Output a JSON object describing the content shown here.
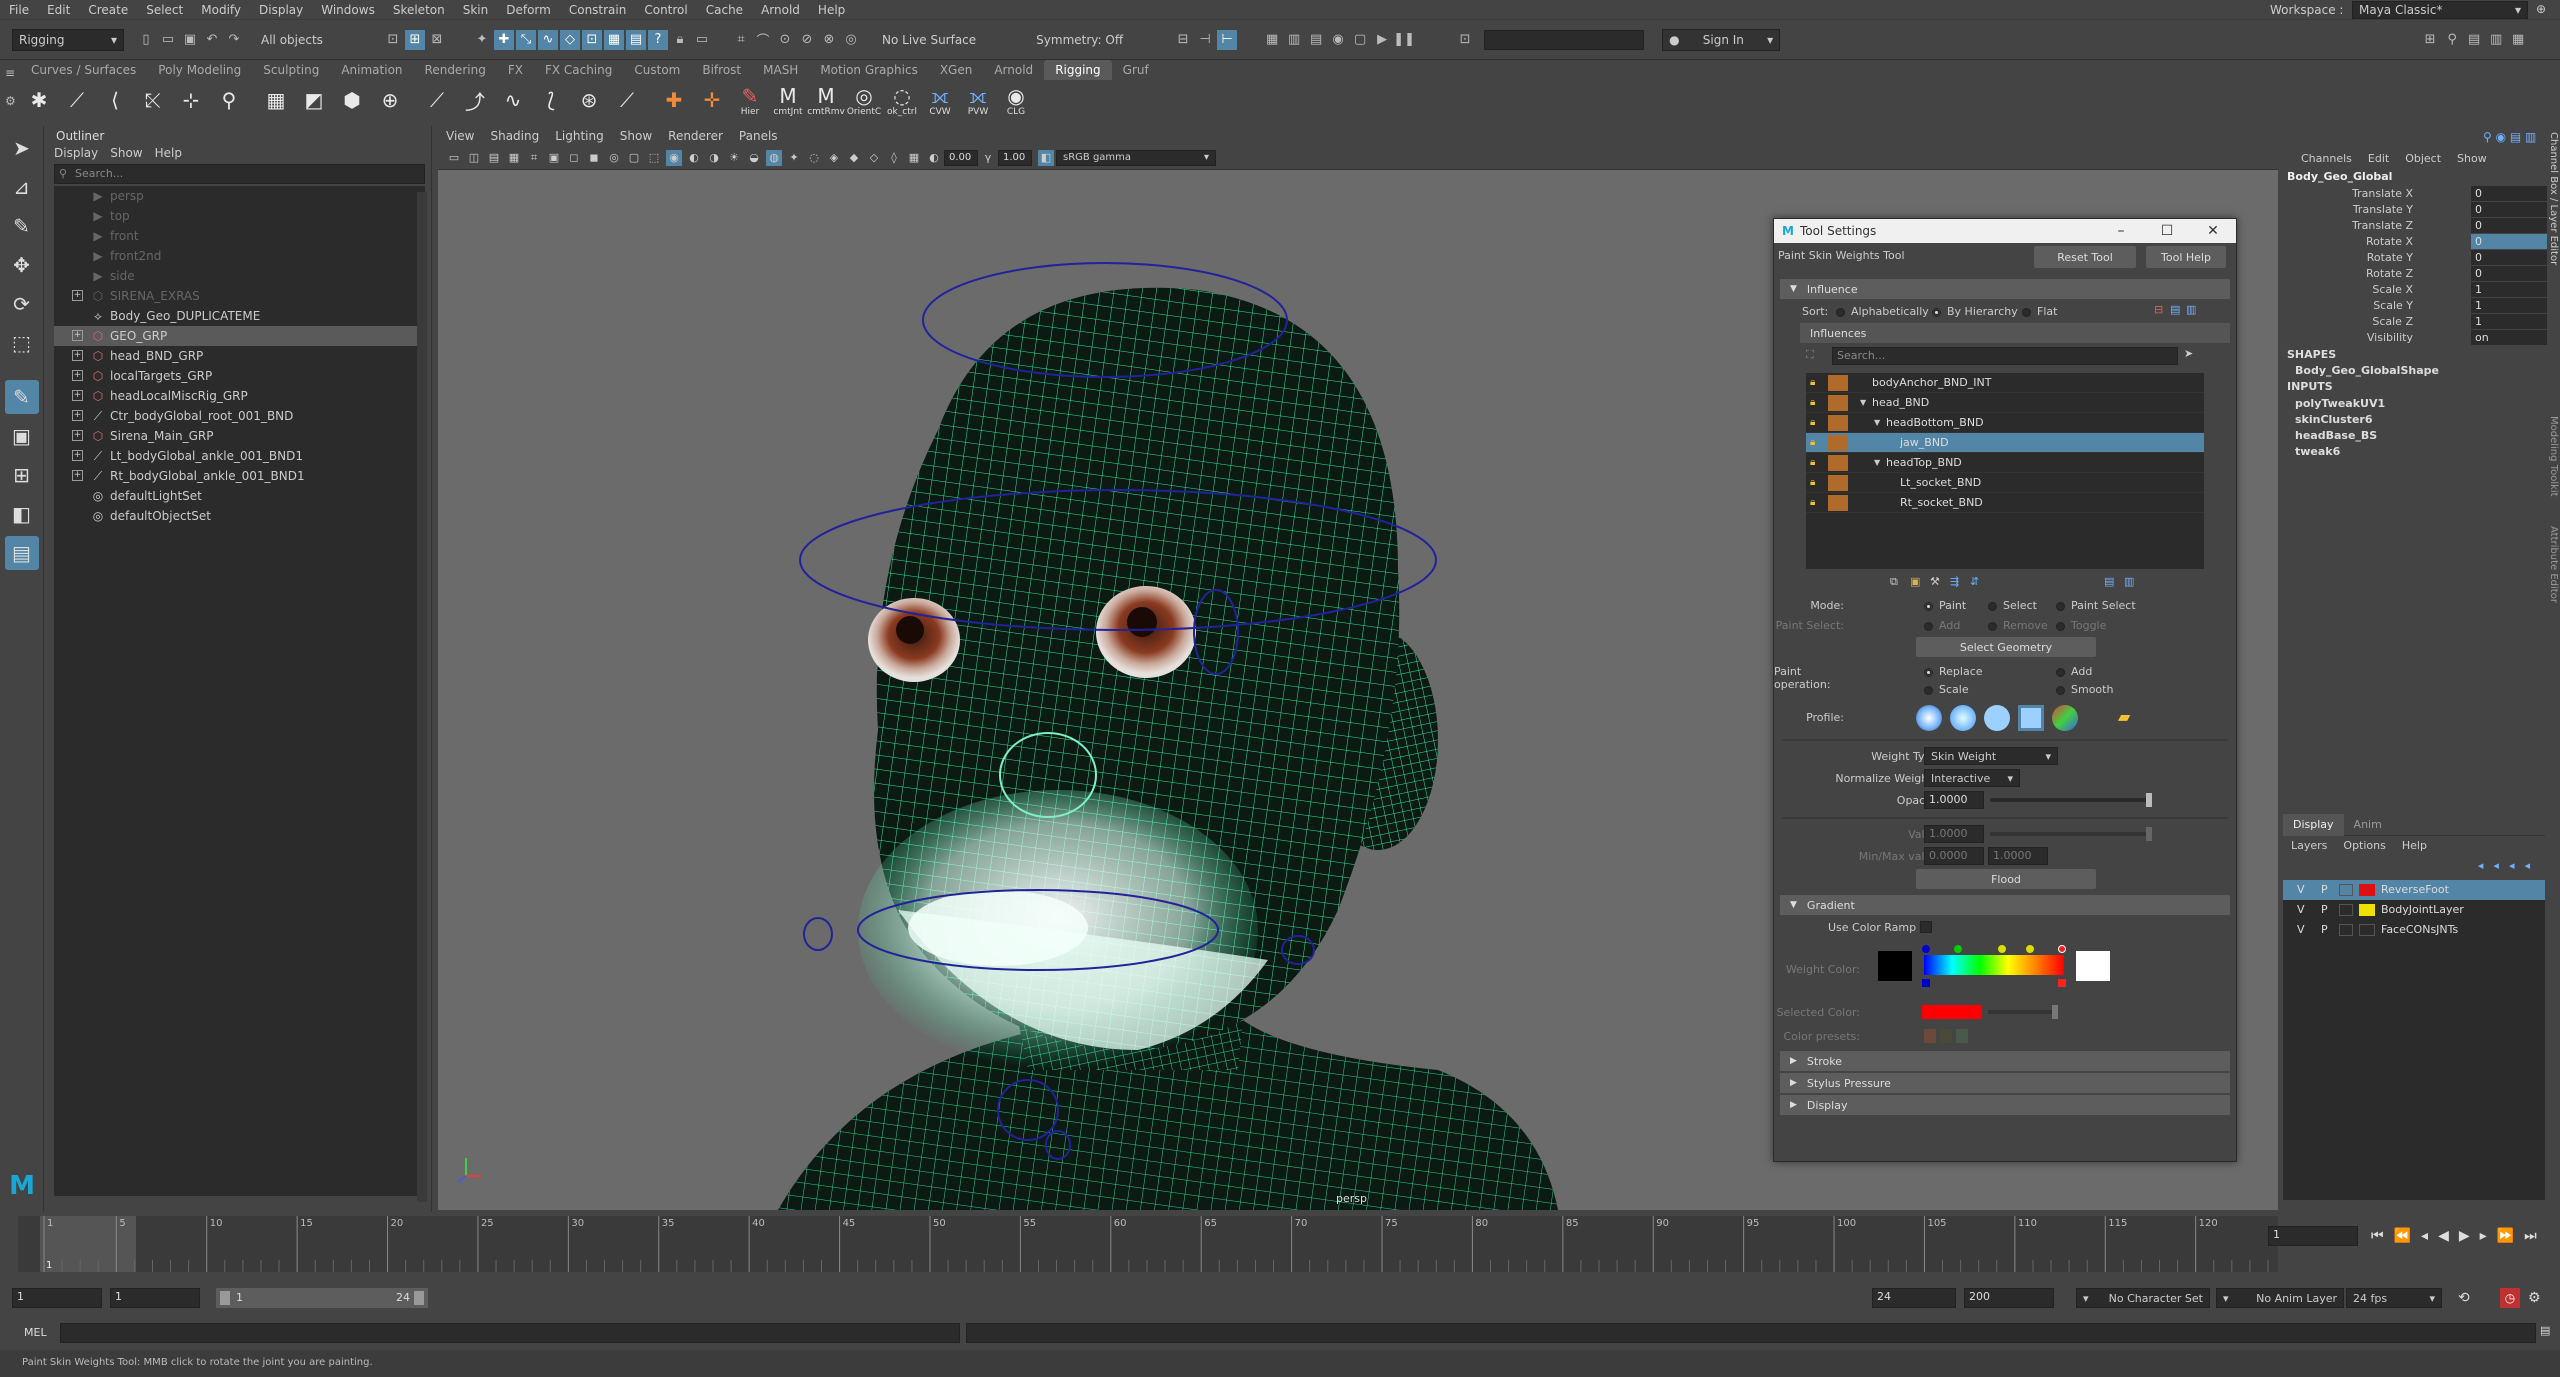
{
  "menubar": {
    "items": [
      "File",
      "Edit",
      "Create",
      "Select",
      "Modify",
      "Display",
      "Windows",
      "Skeleton",
      "Skin",
      "Deform",
      "Constrain",
      "Control",
      "Cache",
      "Arnold",
      "Help"
    ],
    "workspace_label": "Workspace :",
    "workspace_value": "Maya Classic*"
  },
  "statusline": {
    "menuset": "Rigging",
    "select_mode": "All objects",
    "live_surface": "No Live Surface",
    "symmetry": "Symmetry: Off",
    "sign_in": "Sign In"
  },
  "shelf": {
    "tabs": [
      "Curves / Surfaces",
      "Poly Modeling",
      "Sculpting",
      "Animation",
      "Rendering",
      "FX",
      "FX Caching",
      "Custom",
      "Bifrost",
      "MASH",
      "Motion Graphics",
      "XGen",
      "Arnold",
      "Rigging",
      "Gruf"
    ],
    "active_tab": "Rigging",
    "labeled_icons": [
      "Hier",
      "cmtJnt",
      "cmtRmv",
      "OrientC",
      "ok_ctrl",
      "CVW",
      "PVW",
      "CLG"
    ]
  },
  "outliner": {
    "title": "Outliner",
    "menu": [
      "Display",
      "Show",
      "Help"
    ],
    "search_placeholder": "Search...",
    "items": [
      {
        "label": "persp",
        "dim": true,
        "expand": false,
        "icon": "camera-icon"
      },
      {
        "label": "top",
        "dim": true,
        "expand": false,
        "icon": "camera-icon"
      },
      {
        "label": "front",
        "dim": true,
        "expand": false,
        "icon": "camera-icon"
      },
      {
        "label": "front2nd",
        "dim": true,
        "expand": false,
        "icon": "camera-icon"
      },
      {
        "label": "side",
        "dim": true,
        "expand": false,
        "icon": "camera-icon"
      },
      {
        "label": "SIRENA_EXRAS",
        "dim": true,
        "expand": true,
        "icon": "group-icon"
      },
      {
        "label": "Body_Geo_DUPLICATEME",
        "dim": false,
        "expand": false,
        "icon": "transform-icon"
      },
      {
        "label": "GEO_GRP",
        "dim": false,
        "expand": true,
        "icon": "group-icon",
        "selected": true
      },
      {
        "label": "head_BND_GRP",
        "dim": false,
        "expand": true,
        "icon": "group-icon"
      },
      {
        "label": "localTargets_GRP",
        "dim": false,
        "expand": true,
        "icon": "group-icon"
      },
      {
        "label": "headLocalMiscRig_GRP",
        "dim": false,
        "expand": true,
        "icon": "group-icon"
      },
      {
        "label": "Ctr_bodyGlobal_root_001_BND",
        "dim": false,
        "expand": true,
        "icon": "joint-icon"
      },
      {
        "label": "Sirena_Main_GRP",
        "dim": false,
        "expand": true,
        "icon": "group-icon"
      },
      {
        "label": "Lt_bodyGlobal_ankle_001_BND1",
        "dim": false,
        "expand": true,
        "icon": "joint-icon"
      },
      {
        "label": "Rt_bodyGlobal_ankle_001_BND1",
        "dim": false,
        "expand": true,
        "icon": "joint-icon"
      },
      {
        "label": "defaultLightSet",
        "dim": false,
        "expand": false,
        "icon": "set-icon"
      },
      {
        "label": "defaultObjectSet",
        "dim": false,
        "expand": false,
        "icon": "set-icon"
      }
    ]
  },
  "viewport": {
    "menu": [
      "View",
      "Shading",
      "Lighting",
      "Show",
      "Renderer",
      "Panels"
    ],
    "exposure": "0.00",
    "gamma": "1.00",
    "color_space": "sRGB gamma",
    "camera_label": "persp"
  },
  "tool_settings": {
    "window_title": "Tool Settings",
    "tool_name": "Paint Skin Weights Tool",
    "reset_tool": "Reset Tool",
    "tool_help": "Tool Help",
    "influence_frame": "Influence",
    "sort_label": "Sort:",
    "sort_options": [
      "Alphabetically",
      "By Hierarchy",
      "Flat"
    ],
    "sort_selected": "By Hierarchy",
    "influences_label": "Influences",
    "search_placeholder": "Search...",
    "influences": [
      {
        "label": "bodyAnchor_BND_INT",
        "indent": 0,
        "tri": false
      },
      {
        "label": "head_BND",
        "indent": 0,
        "tri": true
      },
      {
        "label": "headBottom_BND",
        "indent": 1,
        "tri": true
      },
      {
        "label": "jaw_BND",
        "indent": 2,
        "tri": false,
        "selected": true
      },
      {
        "label": "headTop_BND",
        "indent": 1,
        "tri": true
      },
      {
        "label": "Lt_socket_BND",
        "indent": 2,
        "tri": false
      },
      {
        "label": "Rt_socket_BND",
        "indent": 2,
        "tri": false
      }
    ],
    "mode_label": "Mode:",
    "mode_options": [
      "Paint",
      "Select",
      "Paint Select"
    ],
    "mode_selected": "Paint",
    "paint_select_label": "Paint Select:",
    "paint_select_options": [
      "Add",
      "Remove",
      "Toggle"
    ],
    "select_geometry": "Select Geometry",
    "paint_operation_label": "Paint operation:",
    "paint_operation_options": [
      "Replace",
      "Add",
      "Scale",
      "Smooth"
    ],
    "paint_operation_selected": "Replace",
    "profile_label": "Profile:",
    "weight_type_label": "Weight Type:",
    "weight_type_value": "Skin Weight",
    "normalize_label": "Normalize Weights:",
    "normalize_value": "Interactive",
    "opacity_label": "Opacity:",
    "opacity_value": "1.0000",
    "opacity_fraction": 1.0,
    "value_label": "Value:",
    "value_value": "1.0000",
    "minmax_label": "Min/Max value:",
    "min_value": "0.0000",
    "max_value": "1.0000",
    "flood": "Flood",
    "gradient_frame": "Gradient",
    "use_color_ramp": "Use Color Ramp",
    "weight_color_label": "Weight Color:",
    "selected_color_label": "Selected Color:",
    "color_presets_label": "Color presets:",
    "stroke_frame": "Stroke",
    "stylus_frame": "Stylus Pressure",
    "display_frame": "Display"
  },
  "channel_box": {
    "menu": [
      "Channels",
      "Edit",
      "Object",
      "Show"
    ],
    "object_name": "Body_Geo_Global",
    "channels": [
      {
        "name": "Translate X",
        "value": "0"
      },
      {
        "name": "Translate Y",
        "value": "0"
      },
      {
        "name": "Translate Z",
        "value": "0"
      },
      {
        "name": "Rotate X",
        "value": "0",
        "highlight": true
      },
      {
        "name": "Rotate Y",
        "value": "0"
      },
      {
        "name": "Rotate Z",
        "value": "0"
      },
      {
        "name": "Scale X",
        "value": "1"
      },
      {
        "name": "Scale Y",
        "value": "1"
      },
      {
        "name": "Scale Z",
        "value": "1"
      },
      {
        "name": "Visibility",
        "value": "on"
      }
    ],
    "shapes_label": "SHAPES",
    "shape_name": "Body_Geo_GlobalShape",
    "inputs_label": "INPUTS",
    "inputs": [
      "polyTweakUV1",
      "skinCluster6",
      "headBase_BS",
      "tweak6"
    ],
    "side_tabs": [
      "Channel Box / Layer Editor",
      "Modeling Toolkit",
      "Attribute Editor"
    ]
  },
  "layer_editor": {
    "tabs": [
      "Display",
      "Anim"
    ],
    "menu": [
      "Layers",
      "Options",
      "Help"
    ],
    "layers": [
      {
        "v": "V",
        "p": "P",
        "color": "#e01010",
        "name": "ReverseFoot",
        "selected": true
      },
      {
        "v": "V",
        "p": "P",
        "color": "#f0e000",
        "name": "BodyJointLayer",
        "selected": false
      },
      {
        "v": "V",
        "p": "P",
        "color": "",
        "name": "FaceCONsJNTs",
        "selected": false
      }
    ]
  },
  "timeline": {
    "ticks": [
      "1",
      "5",
      "10",
      "15",
      "20",
      "25",
      "30",
      "35",
      "40",
      "45",
      "50",
      "55",
      "60",
      "65",
      "70",
      "75",
      "80",
      "85",
      "90",
      "95",
      "100",
      "105",
      "110",
      "115",
      "120"
    ],
    "current_frame_field": "1",
    "current_frame_marker": "1"
  },
  "range": {
    "start": "1",
    "start2": "1",
    "slider_start": "1",
    "slider_end": "24",
    "end": "24",
    "end2": "200",
    "character_set": "No Character Set",
    "anim_layer": "No Anim Layer",
    "fps": "24 fps"
  },
  "command_line": {
    "label": "MEL"
  },
  "help_line": {
    "text": "Paint Skin Weights Tool: MMB click to rotate the joint you are painting."
  },
  "colors": {
    "accent": "#5285a6",
    "wireframe": "#2ee8a0",
    "lock": "#f2c230",
    "swatch": "#b06a2a"
  }
}
